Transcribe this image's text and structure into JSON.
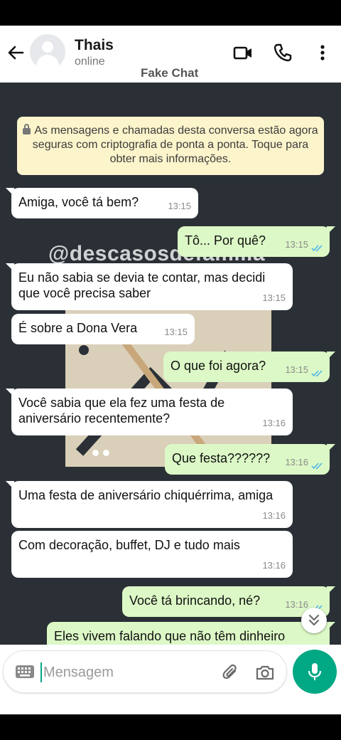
{
  "header": {
    "contact_name": "Thais",
    "status": "online",
    "overlay_label": "Fake Chat"
  },
  "chat": {
    "watermark": "@descasosdefamilia",
    "encryption_notice": "As mensagens e chamadas desta conversa estão agora seguras com criptografia de ponta a ponta. Toque para obter mais informações.",
    "messages": [
      {
        "direction": "in",
        "text": "Amiga, você tá bem?",
        "time": "13:15"
      },
      {
        "direction": "out",
        "text": "Tô... Por quê?",
        "time": "13:15",
        "status": "read"
      },
      {
        "direction": "in",
        "text": "Eu não sabia se devia te contar, mas decidi que você precisa saber",
        "time": "13:15"
      },
      {
        "direction": "in",
        "text": "É sobre a Dona Vera",
        "time": "13:15"
      },
      {
        "direction": "out",
        "text": "O que foi agora?",
        "time": "13:15",
        "status": "read"
      },
      {
        "direction": "in",
        "text": "Você sabia que ela fez uma festa de aniversário recentemente?",
        "time": "13:16"
      },
      {
        "direction": "out",
        "text": "Que festa??????",
        "time": "13:16",
        "status": "read"
      },
      {
        "direction": "in",
        "text": "Uma festa de aniversário chiquérrima, amiga",
        "time": "13:16"
      },
      {
        "direction": "in",
        "text": "Com decoração, buffet, DJ e tudo mais",
        "time": "13:16"
      },
      {
        "direction": "out",
        "text": "Você tá brincando, né?",
        "time": "13:16",
        "status": "read"
      },
      {
        "direction": "out",
        "text": "Eles vivem falando que não têm dinheiro",
        "time": "",
        "status": "",
        "partial": true
      }
    ]
  },
  "input": {
    "placeholder": "Mensagem",
    "value": ""
  },
  "colors": {
    "chat_background": "#2a3036",
    "incoming_bubble": "#ffffff",
    "outgoing_bubble": "#dcf8c6",
    "read_ticks": "#4fb6ec",
    "accent": "#00a884",
    "notice_background": "#fcf4cb"
  },
  "icons": {
    "back": "arrow-left-icon",
    "video_call": "video-call-icon",
    "voice_call": "phone-icon",
    "menu": "more-vertical-icon",
    "keyboard": "keyboard-icon",
    "attach": "paperclip-icon",
    "camera": "camera-icon",
    "mic": "microphone-icon",
    "scroll_down": "chevron-double-down-icon"
  }
}
